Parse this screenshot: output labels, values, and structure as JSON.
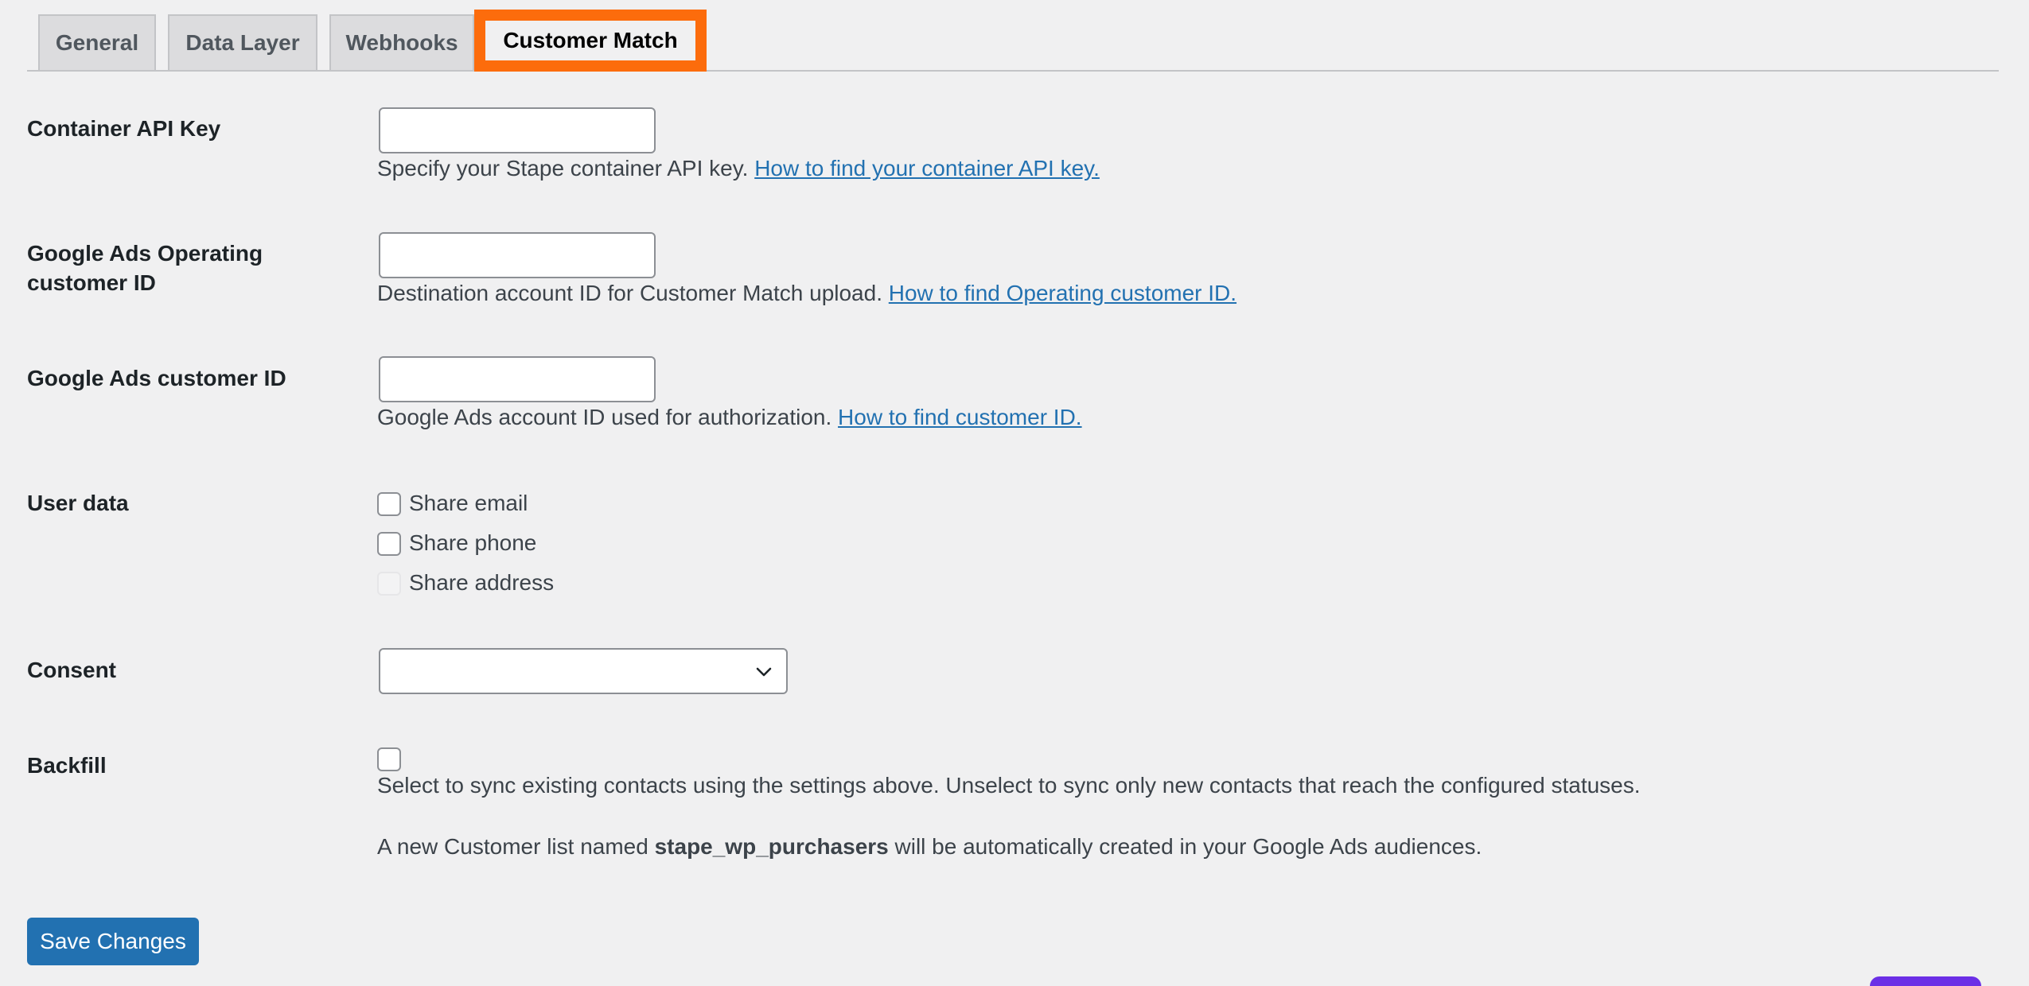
{
  "tabs": [
    {
      "label": "General"
    },
    {
      "label": "Data Layer"
    },
    {
      "label": "Webhooks"
    },
    {
      "label": "Customer Match",
      "active": true
    }
  ],
  "accent_colors": {
    "active_tab_outline": "#fc6c0c",
    "link": "#2271b1",
    "primary_button": "#2271b1"
  },
  "fields": {
    "container_api_key": {
      "label": "Container API Key",
      "value": "",
      "description": "Specify your Stape container API key.",
      "link_text": "How to find your container API key."
    },
    "operating_customer_id": {
      "label_line1": "Google Ads Operating",
      "label_line2": "customer ID",
      "value": "",
      "description": "Destination account ID for Customer Match upload.",
      "link_text": "How to find Operating customer ID."
    },
    "customer_id": {
      "label": "Google Ads customer ID",
      "value": "",
      "description": "Google Ads account ID used for authorization.",
      "link_text": "How to find customer ID."
    },
    "user_data": {
      "label": "User data",
      "options": [
        {
          "label": "Share email",
          "checked": false,
          "disabled": false
        },
        {
          "label": "Share phone",
          "checked": false,
          "disabled": false
        },
        {
          "label": "Share address",
          "checked": false,
          "disabled": true
        }
      ]
    },
    "consent": {
      "label": "Consent",
      "selected": "",
      "icon": "chevron-down-icon"
    },
    "backfill": {
      "label": "Backfill",
      "checked": false,
      "description": "Select to sync existing contacts using the settings above. Unselect to sync only new contacts that reach the configured statuses.",
      "note_prefix": "A new Customer list named",
      "note_bold": "stape_wp_purchasers",
      "note_suffix": "will be automatically created in your Google Ads audiences."
    }
  },
  "save_button": {
    "label": "Save Changes"
  }
}
